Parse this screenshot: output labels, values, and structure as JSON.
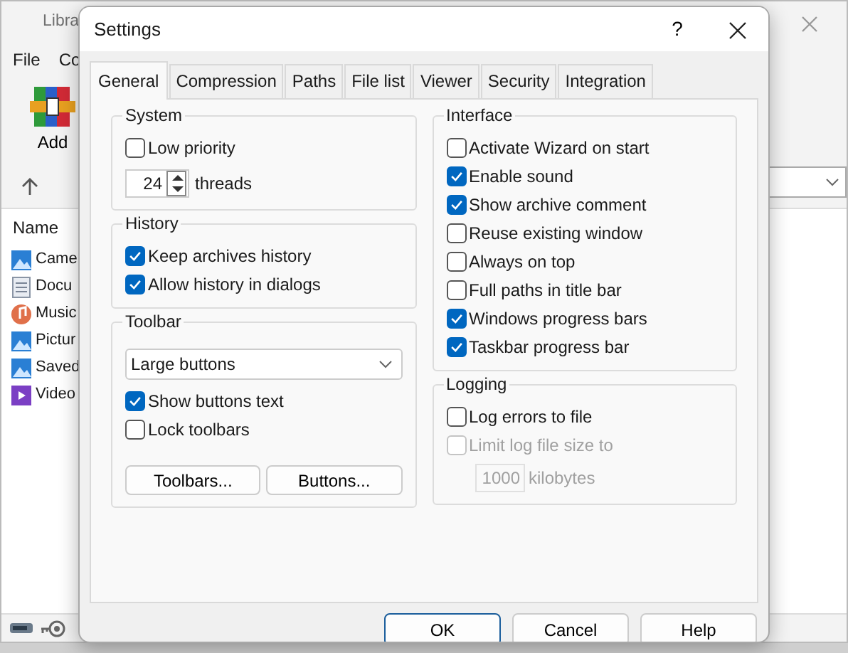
{
  "main_window": {
    "title": "Libra",
    "menu": [
      "File",
      "Co"
    ],
    "toolbar": [
      {
        "label": "Add"
      }
    ],
    "list_header": "Name",
    "files": [
      {
        "name": "Came",
        "kind": "pictures"
      },
      {
        "name": "Docu",
        "kind": "document"
      },
      {
        "name": "Music",
        "kind": "music"
      },
      {
        "name": "Pictur",
        "kind": "pictures"
      },
      {
        "name": "Saved",
        "kind": "pictures"
      },
      {
        "name": "Video",
        "kind": "video"
      }
    ]
  },
  "dialog": {
    "title": "Settings",
    "help": "?",
    "tabs": [
      {
        "label": "General",
        "selected": true
      },
      {
        "label": "Compression",
        "selected": false
      },
      {
        "label": "Paths",
        "selected": false
      },
      {
        "label": "File list",
        "selected": false
      },
      {
        "label": "Viewer",
        "selected": false
      },
      {
        "label": "Security",
        "selected": false
      },
      {
        "label": "Integration",
        "selected": false
      }
    ],
    "left_groups": [
      {
        "title": "System",
        "items": [
          {
            "kind": "checkbox",
            "label": "Low priority",
            "checked": false
          },
          {
            "kind": "spinner",
            "value": "24",
            "label": "threads"
          }
        ]
      },
      {
        "title": "History",
        "items": [
          {
            "kind": "checkbox",
            "label": "Keep archives history",
            "checked": true
          },
          {
            "kind": "checkbox",
            "label": "Allow history in dialogs",
            "checked": true
          }
        ]
      },
      {
        "title": "Toolbar",
        "items": [
          {
            "kind": "select",
            "value": "Large buttons"
          },
          {
            "kind": "checkbox",
            "label": "Show buttons text",
            "checked": true
          },
          {
            "kind": "checkbox",
            "label": "Lock toolbars",
            "checked": false
          },
          {
            "kind": "buttons",
            "buttons": [
              "Toolbars...",
              "Buttons..."
            ]
          }
        ]
      }
    ],
    "right_groups": [
      {
        "title": "Interface",
        "items": [
          {
            "kind": "checkbox",
            "label": "Activate Wizard on start",
            "checked": false
          },
          {
            "kind": "checkbox",
            "label": "Enable sound",
            "checked": true
          },
          {
            "kind": "checkbox",
            "label": "Show archive comment",
            "checked": true
          },
          {
            "kind": "checkbox",
            "label": "Reuse existing window",
            "checked": false
          },
          {
            "kind": "checkbox",
            "label": "Always on top",
            "checked": false
          },
          {
            "kind": "checkbox",
            "label": "Full paths in title bar",
            "checked": false
          },
          {
            "kind": "checkbox",
            "label": "Windows progress bars",
            "checked": true
          },
          {
            "kind": "checkbox",
            "label": "Taskbar progress bar",
            "checked": true
          }
        ]
      },
      {
        "title": "Logging",
        "items": [
          {
            "kind": "checkbox",
            "label": "Log errors to file",
            "checked": false,
            "disabled": false
          },
          {
            "kind": "checkbox",
            "label": "Limit log file size to",
            "checked": false,
            "disabled": true
          },
          {
            "kind": "number",
            "value": "1000",
            "label": "kilobytes",
            "disabled": true
          }
        ]
      }
    ],
    "buttons": [
      {
        "label": "OK",
        "default": true
      },
      {
        "label": "Cancel",
        "default": false
      },
      {
        "label": "Help",
        "default": false
      }
    ]
  }
}
